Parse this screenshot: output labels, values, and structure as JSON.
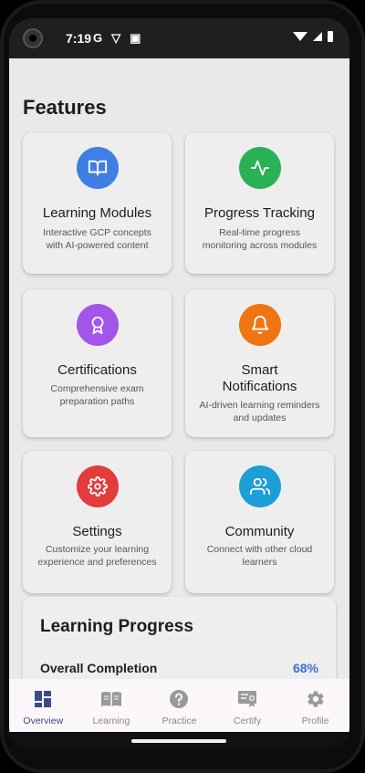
{
  "status_bar": {
    "time": "7:19",
    "left_icons": [
      "G",
      "▽",
      "▣"
    ]
  },
  "section_title": "Features",
  "features": [
    {
      "title": "Learning Modules",
      "desc": "Interactive GCP concepts with AI-powered content",
      "icon": "book-open-icon",
      "color": "#3f7fe3"
    },
    {
      "title": "Progress Tracking",
      "desc": "Real-time progress monitoring across modules",
      "icon": "activity-icon",
      "color": "#2ab055"
    },
    {
      "title": "Certifications",
      "desc": "Comprehensive exam preparation paths",
      "icon": "award-icon",
      "color": "#a255e8"
    },
    {
      "title": "Smart Notifications",
      "desc": "AI-driven learning reminders and updates",
      "icon": "bell-icon",
      "color": "#ee7511"
    },
    {
      "title": "Settings",
      "desc": "Customize your learning experience and preferences",
      "icon": "gear-icon",
      "color": "#e23c3c"
    },
    {
      "title": "Community",
      "desc": "Connect with other cloud learners",
      "icon": "users-icon",
      "color": "#1e9ed7"
    }
  ],
  "learning_progress": {
    "title": "Learning Progress",
    "overall_label": "Overall Completion",
    "overall_value": "68%",
    "accent": "#3b6fd4"
  },
  "bottom_nav": {
    "items": [
      {
        "label": "Overview",
        "icon": "dashboard-icon",
        "active": true
      },
      {
        "label": "Learning",
        "icon": "book-icon",
        "active": false
      },
      {
        "label": "Practice",
        "icon": "help-circle-icon",
        "active": false
      },
      {
        "label": "Certify",
        "icon": "certificate-icon",
        "active": false
      },
      {
        "label": "Profile",
        "icon": "gear-icon",
        "active": false
      }
    ]
  }
}
